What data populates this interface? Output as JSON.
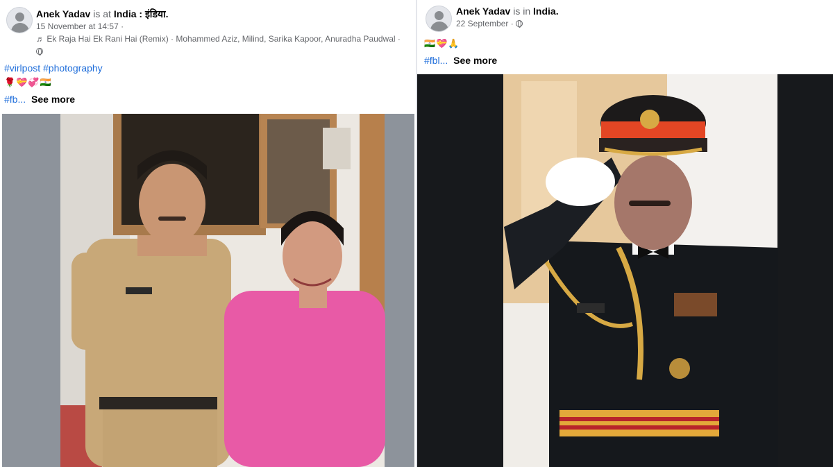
{
  "posts": [
    {
      "author": "Anek Yadav",
      "connector": "is at",
      "place": "India : इंडिया.",
      "timestamp": "15 November at 14:57 ·",
      "music": "♬ Ek Raja Hai Ek Rani Hai (Remix) · Mohammed Aziz, Milind, Sarika Kapoor, Anuradha Paudwal ·",
      "privacy_icon": "globe-icon",
      "hashtags_line": "#virlpost #photography",
      "emoji_line": "🌹💝💞🇮🇳",
      "tail_hashtag": "#fb...",
      "see_more": "See more"
    },
    {
      "author": "Anek Yadav",
      "connector": "is in",
      "place": "India.",
      "timestamp": "22 September ·",
      "privacy_icon": "globe-icon",
      "emoji_line": "🇮🇳💝🙏",
      "tail_hashtag": "#fbl...",
      "see_more": "See more"
    }
  ],
  "colors": {
    "link": "#216fdb",
    "secondary_text": "#65676b",
    "primary_text": "#050505"
  }
}
